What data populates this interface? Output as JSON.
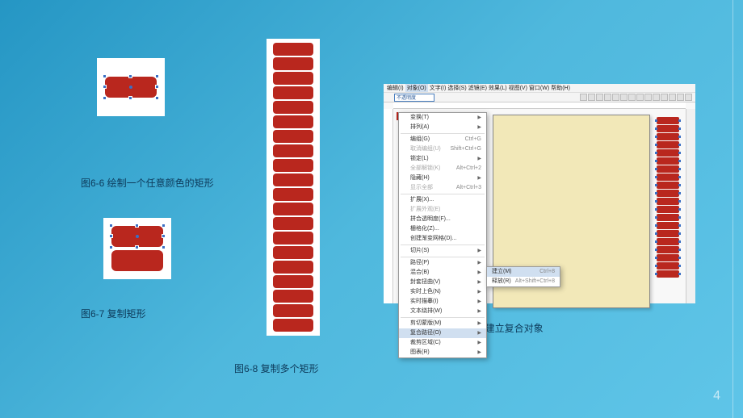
{
  "captions": {
    "fig66": "图6-6 绘制一个任意颜色的矩形",
    "fig67": "图6-7 复制矩形",
    "fig68": "图6-8 复制多个矩形",
    "fig69": "图6-9 建立复合对象"
  },
  "page_number": "4",
  "app": {
    "menubar": [
      "编辑(I)",
      "对象(O)",
      "文字(I)",
      "选择(S)",
      "滤镜(E)",
      "效果(L)",
      "视图(V)",
      "窗口(W)",
      "帮助(H)"
    ],
    "toolbar_dropdown": "不透明度",
    "menu": {
      "items": [
        {
          "label": "变换(T)",
          "arrow": true
        },
        {
          "label": "排列(A)",
          "arrow": true
        },
        {
          "sep": true
        },
        {
          "label": "编组(G)",
          "shortcut": "Ctrl+G"
        },
        {
          "label": "取消编组(U)",
          "shortcut": "Shift+Ctrl+G",
          "dim": true
        },
        {
          "label": "锁定(L)",
          "arrow": true
        },
        {
          "label": "全部解锁(K)",
          "shortcut": "Alt+Ctrl+2",
          "dim": true
        },
        {
          "label": "隐藏(H)",
          "arrow": true
        },
        {
          "label": "显示全部",
          "shortcut": "Alt+Ctrl+3",
          "dim": true
        },
        {
          "sep": true
        },
        {
          "label": "扩展(X)..."
        },
        {
          "label": "扩展外观(E)",
          "dim": true
        },
        {
          "label": "拼合透明度(F)..."
        },
        {
          "label": "栅格化(Z)..."
        },
        {
          "label": "创建渐变网格(D)..."
        },
        {
          "sep": true
        },
        {
          "label": "切片(S)",
          "arrow": true
        },
        {
          "sep": true
        },
        {
          "label": "路径(P)",
          "arrow": true
        },
        {
          "label": "混合(B)",
          "arrow": true
        },
        {
          "label": "封套扭曲(V)",
          "arrow": true
        },
        {
          "label": "实时上色(N)",
          "arrow": true
        },
        {
          "label": "实时描摹(I)",
          "arrow": true
        },
        {
          "label": "文本绕排(W)",
          "arrow": true
        },
        {
          "sep": true
        },
        {
          "label": "剪切蒙版(M)",
          "arrow": true
        },
        {
          "label": "复合路径(O)",
          "arrow": true,
          "hl": true
        },
        {
          "label": "裁剪区域(C)",
          "arrow": true
        },
        {
          "label": "图表(R)",
          "arrow": true
        }
      ]
    },
    "submenu": {
      "items": [
        {
          "label": "建立(M)",
          "shortcut": "Ctrl+8",
          "hl": true
        },
        {
          "label": "释放(R)",
          "shortcut": "Alt+Shift+Ctrl+8"
        }
      ]
    }
  }
}
